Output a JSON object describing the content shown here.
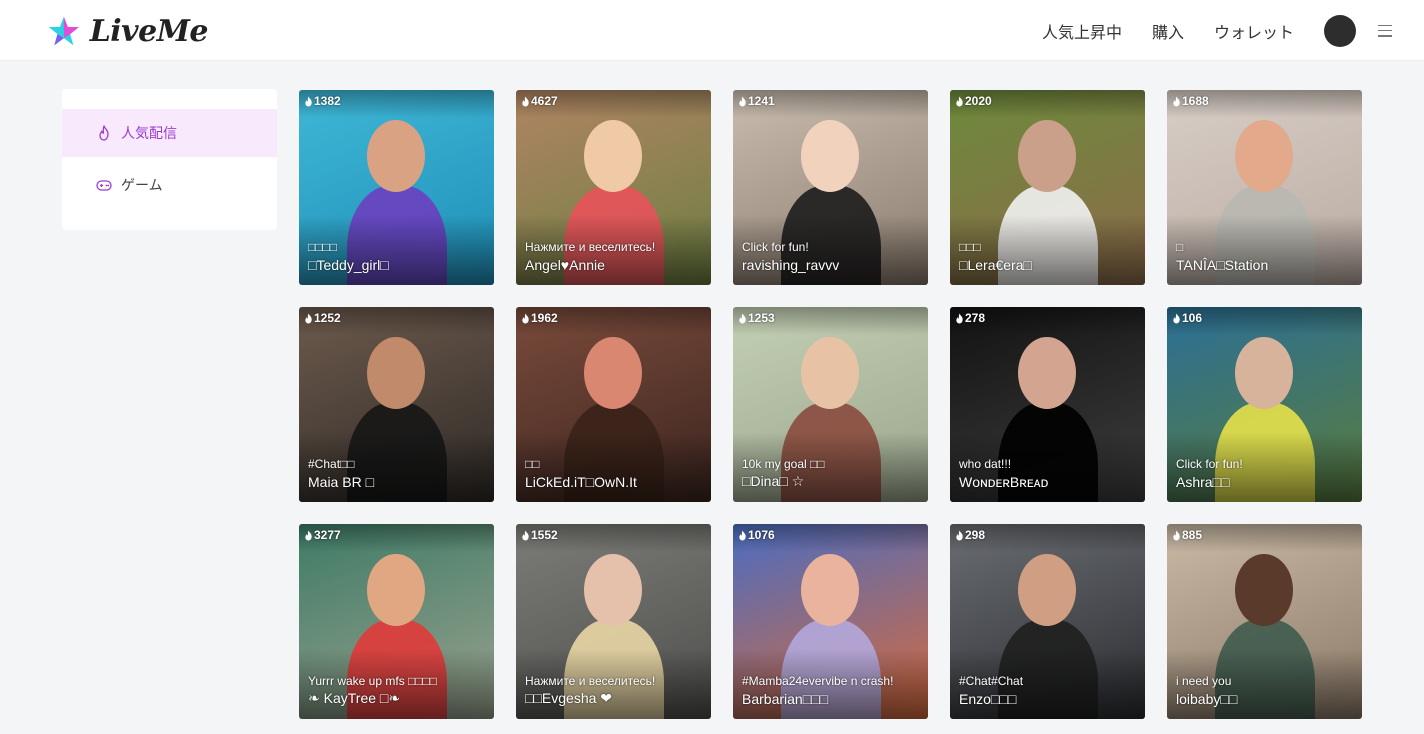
{
  "header": {
    "logo_text": "LiveMe",
    "nav": [
      "人気上昇中",
      "購入",
      "ウォレット"
    ]
  },
  "sidebar": {
    "items": [
      {
        "label": "人気配信",
        "icon": "flame-icon",
        "active": true
      },
      {
        "label": "ゲーム",
        "icon": "gamepad-icon",
        "active": false
      }
    ]
  },
  "colors": {
    "accent": "#9c3bd0",
    "active_bg": "#f8e9fc",
    "logo_cyan": "#29d3e6",
    "logo_pink": "#e44bd6"
  },
  "streams": [
    {
      "viewers": "1382",
      "caption": "□□□□",
      "name": "□Teddy_girl□",
      "bg": [
        "#3fb7d6",
        "#1f8fb8"
      ],
      "skin": "#d9a282",
      "accent": "#6a3fc0"
    },
    {
      "viewers": "4627",
      "caption": "Нажмите и веселитесь!",
      "name": "Angel♥Annie",
      "bg": [
        "#b08463",
        "#6d7f42"
      ],
      "skin": "#f0c9a7",
      "accent": "#e8525a"
    },
    {
      "viewers": "1241",
      "caption": "Click for fun!",
      "name": "ravishing_ravvv",
      "bg": [
        "#c9bdb0",
        "#8a7b6d"
      ],
      "skin": "#f1d2bc",
      "accent": "#1d1d1d"
    },
    {
      "viewers": "2020",
      "caption": "□□□",
      "name": "□Lera€era□",
      "bg": [
        "#6c8a3b",
        "#8e6b4b"
      ],
      "skin": "#caa08b",
      "accent": "#f2f2f2"
    },
    {
      "viewers": "1688",
      "caption": "□",
      "name": "TANÎA□Station",
      "bg": [
        "#d8cec6",
        "#b9aba2"
      ],
      "skin": "#e2a98b",
      "accent": "#b8b8b0"
    },
    {
      "viewers": "1252",
      "caption": "#Chat□□",
      "name": "Maia BR □",
      "bg": [
        "#6d5a4c",
        "#2e2a27"
      ],
      "skin": "#c08a6b",
      "accent": "#161616"
    },
    {
      "viewers": "1962",
      "caption": "□□",
      "name": "LiCkEd.iT□OwN.It",
      "bg": [
        "#7a4b3b",
        "#3c2520"
      ],
      "skin": "#d98771",
      "accent": "#3a2218"
    },
    {
      "viewers": "1253",
      "caption": "10k my goal □□",
      "name": "□Dina□ ☆",
      "bg": [
        "#c4d0b4",
        "#9aa58d"
      ],
      "skin": "#e8c2a5",
      "accent": "#8b4b3e"
    },
    {
      "viewers": "278",
      "caption": "who dat!!!",
      "name": "WᴏɴᴅᴇʀBʀᴇᴀᴅ",
      "bg": [
        "#121212",
        "#3e3e3e"
      ],
      "skin": "#d3a590",
      "accent": "#000000"
    },
    {
      "viewers": "106",
      "caption": "Click for fun!",
      "name": "Ashra□□",
      "bg": [
        "#2a6f96",
        "#5b7d3d"
      ],
      "skin": "#d8b39c",
      "accent": "#e6e14a"
    },
    {
      "viewers": "3277",
      "caption": "Yurrr wake up mfs □□□□",
      "name": "❧ KayTree □❧",
      "bg": [
        "#3e7b66",
        "#9aa28e"
      ],
      "skin": "#e0a782",
      "accent": "#e13a3a"
    },
    {
      "viewers": "1552",
      "caption": "Нажмите и веселитесь!",
      "name": "□□Evgesha ❤",
      "bg": [
        "#7c7c78",
        "#4e4e4c"
      ],
      "skin": "#e5c1ab",
      "accent": "#e9d6a4"
    },
    {
      "viewers": "1076",
      "caption": "#Mamba24evervibe n crash!",
      "name": "Barbarian□□□",
      "bg": [
        "#4a6dc2",
        "#d96a3a"
      ],
      "skin": "#e9b39d",
      "accent": "#b3a8dc"
    },
    {
      "viewers": "298",
      "caption": "#Chat#Chat",
      "name": "Enzo□□□",
      "bg": [
        "#6a6d72",
        "#2b2d31"
      ],
      "skin": "#cf9e83",
      "accent": "#1f1f1f"
    },
    {
      "viewers": "885",
      "caption": "i need you",
      "name": "loibaby□□",
      "bg": [
        "#c9b9a5",
        "#8b7a68"
      ],
      "skin": "#5a3a2b",
      "accent": "#3f5b4e"
    }
  ]
}
